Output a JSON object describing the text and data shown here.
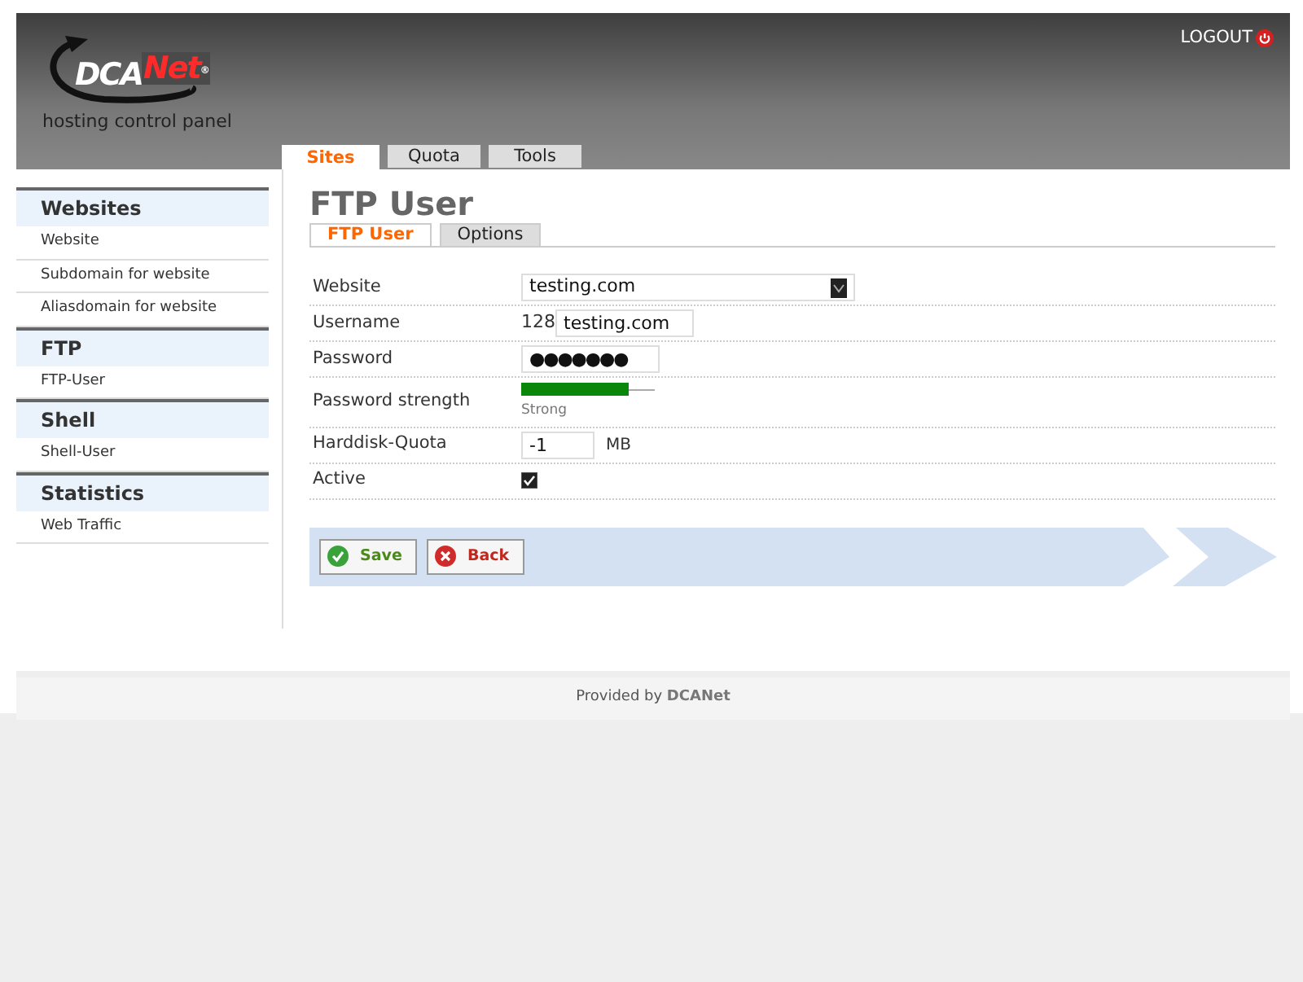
{
  "header": {
    "logo": {
      "main": "DCA",
      "accent": "Net",
      "mark": "®"
    },
    "subtitle": "hosting control panel",
    "logout": "LOGOUT"
  },
  "tabs": [
    {
      "label": "Sites",
      "selected": true
    },
    {
      "label": "Quota",
      "selected": false
    },
    {
      "label": "Tools",
      "selected": false
    }
  ],
  "sidebar": [
    {
      "heading": "Websites",
      "items": [
        "Website",
        "Subdomain for website",
        "Aliasdomain for website"
      ]
    },
    {
      "heading": "FTP",
      "items": [
        "FTP-User"
      ]
    },
    {
      "heading": "Shell",
      "items": [
        "Shell-User"
      ]
    },
    {
      "heading": "Statistics",
      "items": [
        "Web Traffic"
      ]
    }
  ],
  "page_title": "FTP User",
  "subtabs": [
    {
      "label": "FTP User",
      "selected": true
    },
    {
      "label": "Options",
      "selected": false
    }
  ],
  "form": [
    {
      "kind": "select",
      "label": "Website",
      "value": "testing.com"
    },
    {
      "kind": "prefixed",
      "label": "Username",
      "prefix": "128",
      "value": "testing.com"
    },
    {
      "kind": "text",
      "label": "Password",
      "value": "●●●●●●●"
    },
    {
      "kind": "meter",
      "label": "Password strength",
      "level": 0.8,
      "reading": "Strong"
    },
    {
      "kind": "unit",
      "label": "Harddisk-Quota",
      "value": "-1",
      "unit": "MB"
    },
    {
      "kind": "checkbox",
      "label": "Active",
      "checked": true
    }
  ],
  "buttons": [
    {
      "kind": "save",
      "label": "Save"
    },
    {
      "kind": "back",
      "label": "Back"
    }
  ],
  "footer": {
    "text": "Provided by ",
    "brand": "DCANet"
  }
}
